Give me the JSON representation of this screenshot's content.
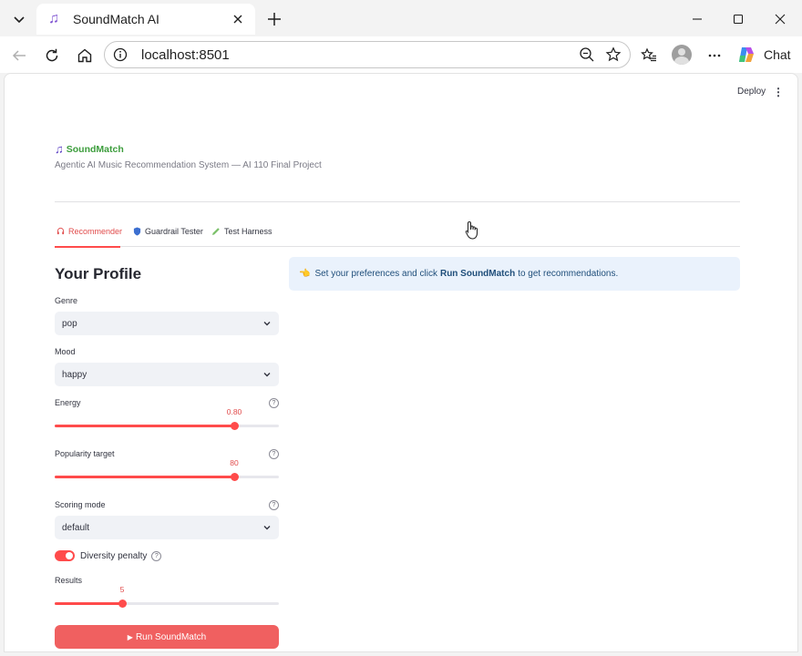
{
  "browser": {
    "tab_title": "SoundMatch AI",
    "address": "localhost:8501",
    "chat_label": "Chat"
  },
  "app": {
    "deploy_label": "Deploy",
    "brand_title": "SoundMatch",
    "subtitle": "Agentic AI Music Recommendation System — AI 110 Final Project",
    "tabs": [
      {
        "label": "Recommender",
        "icon": "headphones-icon",
        "active": true
      },
      {
        "label": "Guardrail Tester",
        "icon": "shield-icon",
        "active": false
      },
      {
        "label": "Test Harness",
        "icon": "pencil-icon",
        "active": false
      }
    ],
    "profile_title": "Your Profile",
    "genre": {
      "label": "Genre",
      "value": "pop"
    },
    "mood": {
      "label": "Mood",
      "value": "happy"
    },
    "energy": {
      "label": "Energy",
      "value": "0.80",
      "fraction": 0.8
    },
    "popularity": {
      "label": "Popularity target",
      "value": "80",
      "fraction": 0.8
    },
    "scoring": {
      "label": "Scoring mode",
      "value": "default"
    },
    "diversity": {
      "label": "Diversity penalty",
      "enabled": true
    },
    "results": {
      "label": "Results",
      "value": "5",
      "fraction": 0.3
    },
    "run_button": "Run SoundMatch",
    "info": {
      "prefix": "Set your preferences and click",
      "bold": "Run SoundMatch",
      "suffix": "to get recommendations."
    },
    "colors": {
      "accent": "#ff4b4b",
      "brand": "#3c9d3c",
      "info_bg": "#eaf2fc"
    }
  }
}
